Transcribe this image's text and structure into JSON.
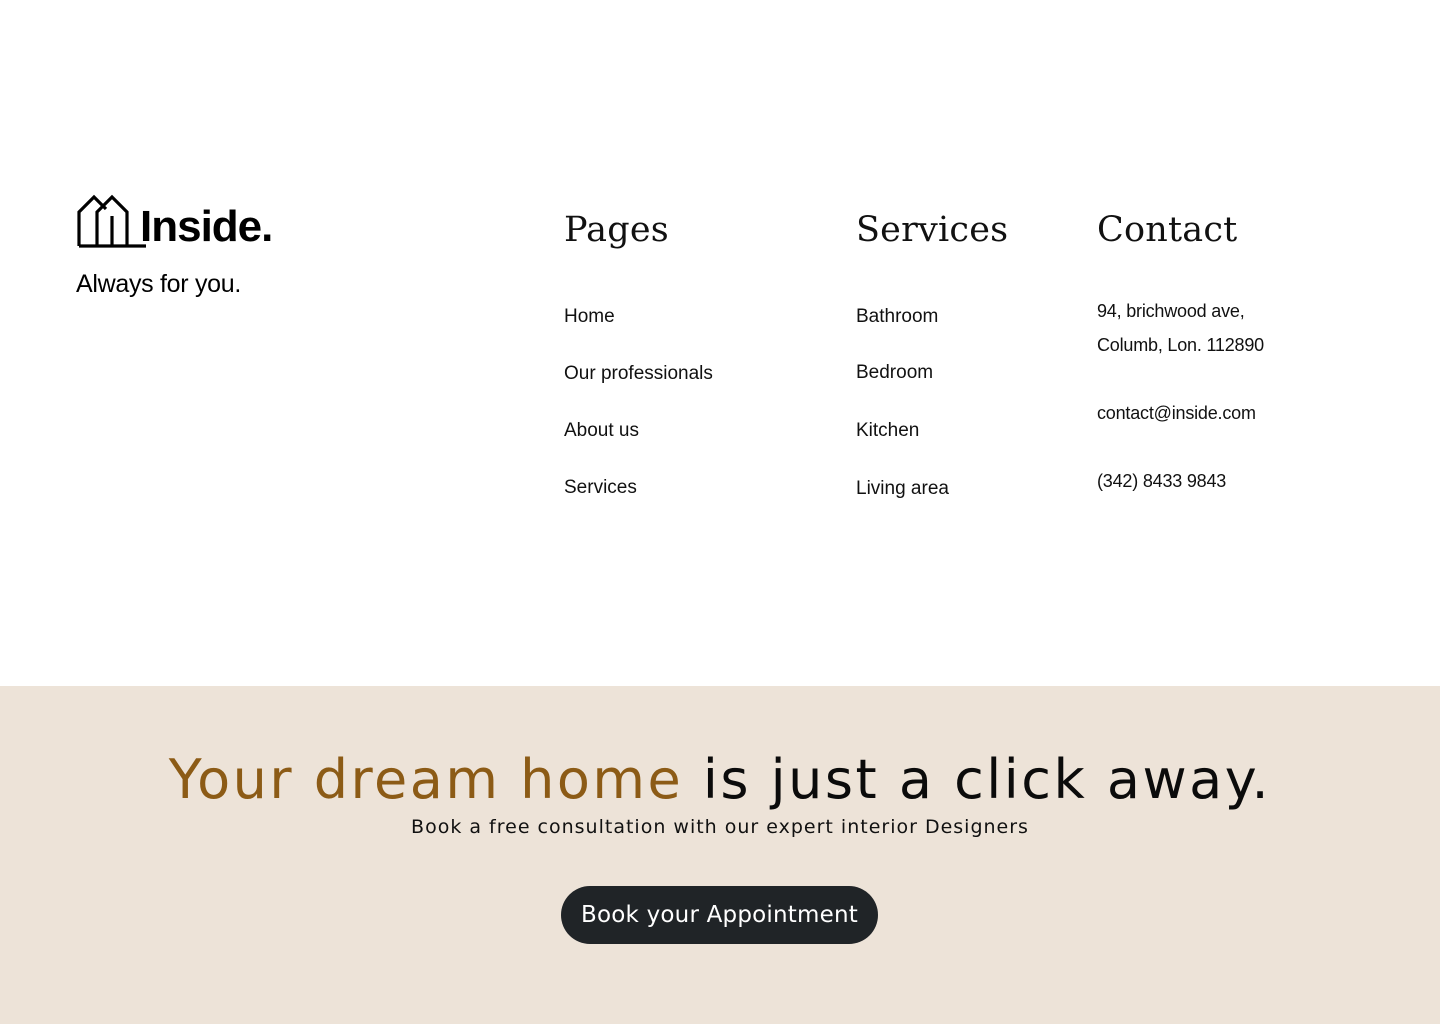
{
  "brand": {
    "logo_text": "Inside.",
    "tagline": "Always for you."
  },
  "pages": {
    "heading": "Pages",
    "items": [
      "Home",
      "Our professionals",
      "About us",
      "Services"
    ]
  },
  "services": {
    "heading": "Services",
    "items": [
      "Bathroom",
      "Bedroom",
      "Kitchen",
      "Living area"
    ]
  },
  "contact": {
    "heading": "Contact",
    "address_line1": "94, brichwood ave,",
    "address_line2": "Columb, Lon. 112890",
    "email": "contact@inside.com",
    "phone": "(342) 8433 9843"
  },
  "cta": {
    "headline_accent": "Your dream home",
    "headline_rest": " is just a click away.",
    "subtitle": "Book a free consultation with our expert interior Designers",
    "button_label": "Book your Appointment"
  },
  "colors": {
    "accent": "#8c5b16",
    "cta_background": "#ede3d8",
    "button_background": "#202427",
    "text": "#111111"
  },
  "icons": {
    "logo": "house-outline-icon"
  }
}
